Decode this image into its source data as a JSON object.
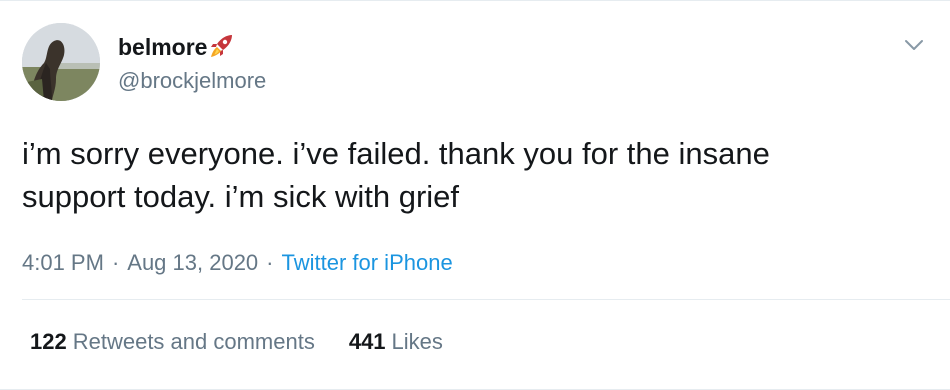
{
  "user": {
    "display_name": "belmore",
    "username": "@brockjelmore",
    "name_emoji": "rocket-icon",
    "avatar": "avatar"
  },
  "tweet": {
    "text_line_1": "i’m sorry everyone. i’ve failed. thank you for the insane",
    "text_line_2": "support today. i’m sick with grief"
  },
  "meta": {
    "time": "4:01 PM",
    "separator": "·",
    "date": "Aug 13, 2020",
    "source": "Twitter for iPhone"
  },
  "stats": {
    "retweets_count": "122",
    "retweets_label": "Retweets and comments",
    "likes_count": "441",
    "likes_label": "Likes"
  },
  "colors": {
    "text": "#14171a",
    "secondary": "#657786",
    "link": "#1b95e0",
    "border": "#e6ecf0"
  },
  "icons": {
    "menu": "chevron-down-icon"
  }
}
